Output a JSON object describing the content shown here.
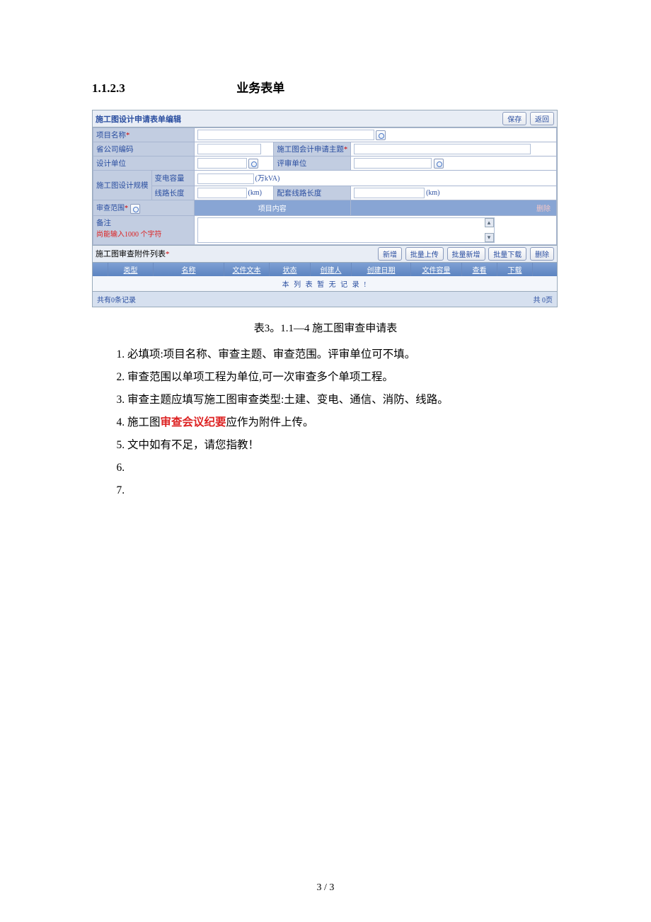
{
  "heading": {
    "num": "1.1.2.3",
    "title": "业务表单"
  },
  "form_header": {
    "title": "施工图设计申请表单编辑",
    "save_btn": "保存",
    "back_btn": "返回"
  },
  "labels": {
    "project_name": "项目名称",
    "company_code": "省公司编码",
    "apply_topic": "施工图会计申请主题",
    "design_unit": "设计单位",
    "review_unit": "评审单位",
    "scale_group": "施工图设计规模",
    "capacity": "变电容量",
    "capacity_unit": "(万kVA)",
    "line_len": "线路长度",
    "line_len_unit": "(km)",
    "pair_line": "配套线路长度",
    "pair_line_unit": "(km)",
    "review_scope": "审查范围",
    "project_content": "项目内容",
    "delete": "删除",
    "remark": "备注",
    "remark_hint": "尚能输入1000 个字符"
  },
  "attach": {
    "title": "施工图审查附件列表",
    "btn_add": "新增",
    "btn_batch_upload": "批量上传",
    "btn_batch_add": "批量新增",
    "btn_batch_download": "批量下载",
    "btn_delete": "删除",
    "cols": {
      "type": "类型",
      "name": "名称",
      "file": "文件文本",
      "status": "状态",
      "creator": "创建人",
      "date": "创建日期",
      "size": "文件容量",
      "view": "查看",
      "download": "下载"
    },
    "empty": "本 列 表 暂 无 记 录 !",
    "footer_left": "共有0条记录",
    "footer_right": "共 0页"
  },
  "caption": "表3。1.1—4  施工图审查申请表",
  "notes": {
    "n1": "必填项:项目名称、审查主题、审查范围。评审单位可不填。",
    "n2": "审查范围以单项工程为单位,可一次审查多个单项工程。",
    "n3": "审查主题应填写施工图审查类型:土建、变电、通信、消防、线路。",
    "n4a": "施工图",
    "n4b": "审查会议纪要",
    "n4c": "应作为附件上传。",
    "n5": "文中如有不足，请您指教！",
    "n6": "",
    "n7": ""
  },
  "page_number": "3 / 3"
}
